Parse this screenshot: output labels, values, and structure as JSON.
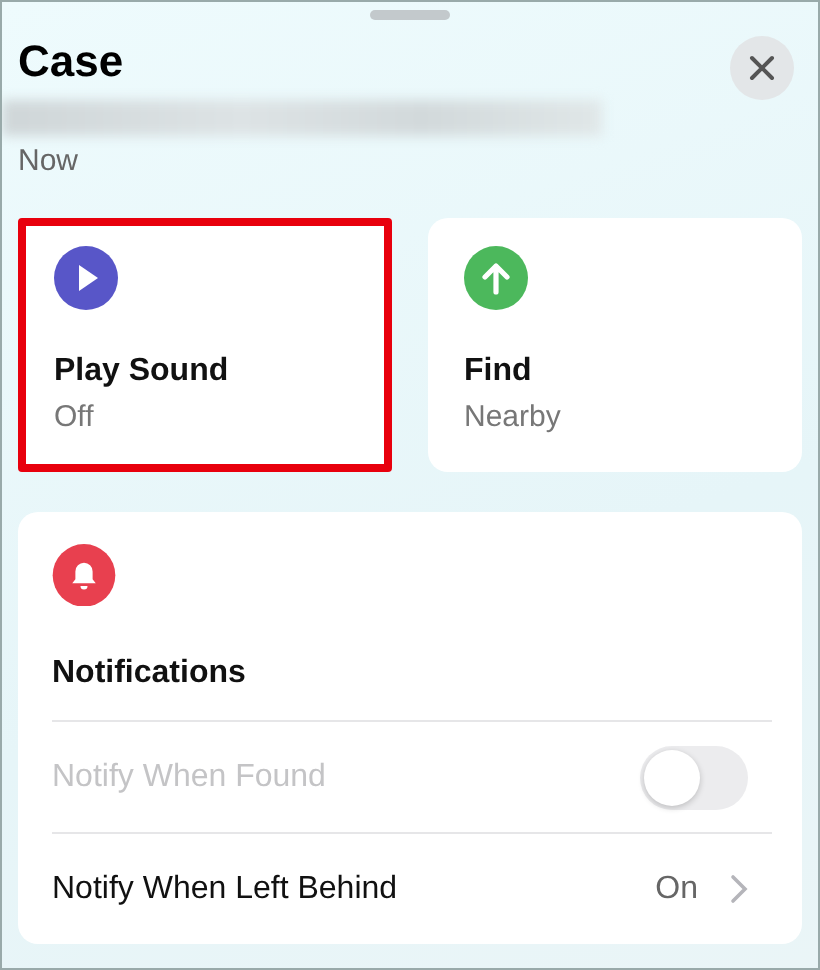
{
  "sheet": {
    "title": "Case",
    "subtitle": "Now"
  },
  "actions": [
    {
      "kind": "play",
      "title": "Play Sound",
      "detail": "Off",
      "highlighted": true
    },
    {
      "kind": "find",
      "title": "Find",
      "detail": "Nearby",
      "highlighted": false
    }
  ],
  "notifications": {
    "title": "Notifications",
    "rows": [
      {
        "kind": "toggle",
        "label": "Notify When Found",
        "disabled": true,
        "on": false
      },
      {
        "kind": "link",
        "label": "Notify When Left Behind",
        "disabled": false,
        "value": "On"
      }
    ]
  }
}
